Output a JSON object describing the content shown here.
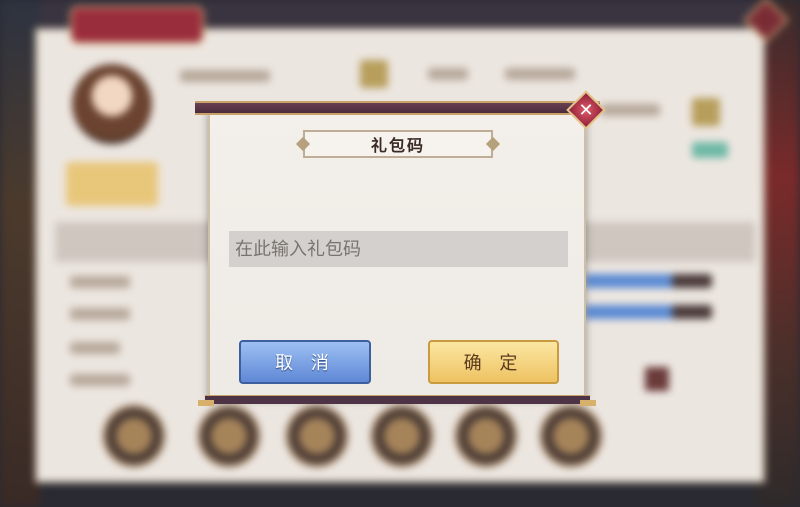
{
  "dialog": {
    "title": "礼包码",
    "close_icon": "close-icon",
    "input": {
      "placeholder": "在此输入礼包码",
      "value": ""
    },
    "cancel_label": "取 消",
    "confirm_label": "确 定"
  },
  "colors": {
    "cancel_button": "#6f97dd",
    "confirm_button": "#f3d27c",
    "close_button": "#b5344c",
    "frame": "#4e3346"
  }
}
